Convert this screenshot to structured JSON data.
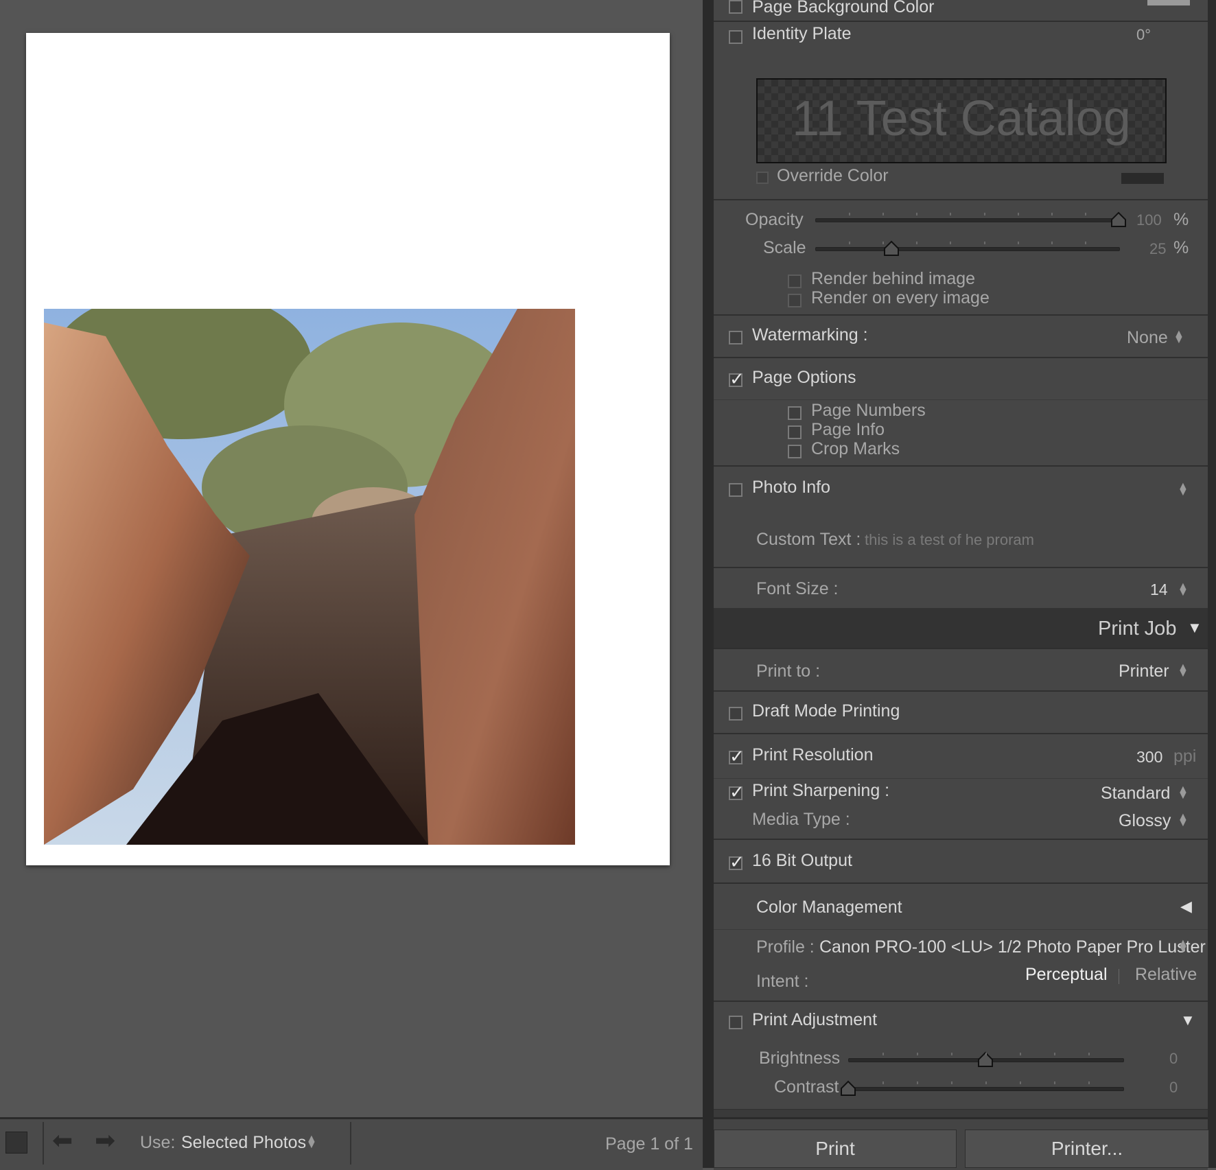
{
  "preview": {
    "photo_caption": ""
  },
  "identity_plate": {
    "cut_label": "Page Background Color",
    "label": "Identity Plate",
    "angle": "0°",
    "plate_text": "11 Test Catalog",
    "override_color": "Override Color",
    "opacity_label": "Opacity",
    "opacity_value": "100",
    "opacity_fraction": 1.0,
    "scale_label": "Scale",
    "scale_value": "25",
    "scale_fraction": 0.25,
    "percent": "%",
    "render_behind": "Render behind image",
    "render_every": "Render on every image"
  },
  "watermarking": {
    "label": "Watermarking :",
    "value": "None"
  },
  "page_options": {
    "label": "Page Options",
    "page_numbers": "Page Numbers",
    "page_info": "Page Info",
    "crop_marks": "Crop Marks"
  },
  "photo_info": {
    "label": "Photo Info",
    "custom_text_label": "Custom Text :",
    "custom_text_value": "this is a test of he proram",
    "font_size_label": "Font Size :",
    "font_size_value": "14"
  },
  "print_job": {
    "header": "Print Job",
    "print_to_label": "Print to :",
    "print_to_value": "Printer",
    "draft_mode": "Draft Mode Printing",
    "print_resolution": "Print Resolution",
    "resolution_value": "300",
    "resolution_unit": "ppi",
    "print_sharpening": "Print Sharpening :",
    "sharpening_value": "Standard",
    "media_type_label": "Media Type :",
    "media_type_value": "Glossy",
    "bit_output": "16 Bit Output",
    "color_management": "Color Management",
    "profile_label": "Profile :",
    "profile_value": "Canon PRO-100 <LU> 1/2 Photo Paper Pro Luster",
    "intent_label": "Intent :",
    "intent_perceptual": "Perceptual",
    "intent_relative": "Relative",
    "print_adjustment": "Print Adjustment",
    "brightness_label": "Brightness",
    "brightness_value": "0",
    "brightness_fraction": 0.5,
    "contrast_label": "Contrast",
    "contrast_value": "0",
    "contrast_fraction": 0.0
  },
  "toolbar": {
    "use_label": "Use:",
    "use_value": "Selected Photos",
    "page_indicator": "Page 1 of 1",
    "print_button": "Print",
    "printer_button": "Printer..."
  },
  "colors": {
    "panel_bg": "#464646",
    "background": "#555555",
    "paper": "#ffffff"
  },
  "icons": [
    "checkbox-icon",
    "updown-arrow-icon",
    "disclosure-triangle-icon",
    "back-arrow-icon",
    "forward-arrow-icon",
    "stop-square-icon"
  ]
}
